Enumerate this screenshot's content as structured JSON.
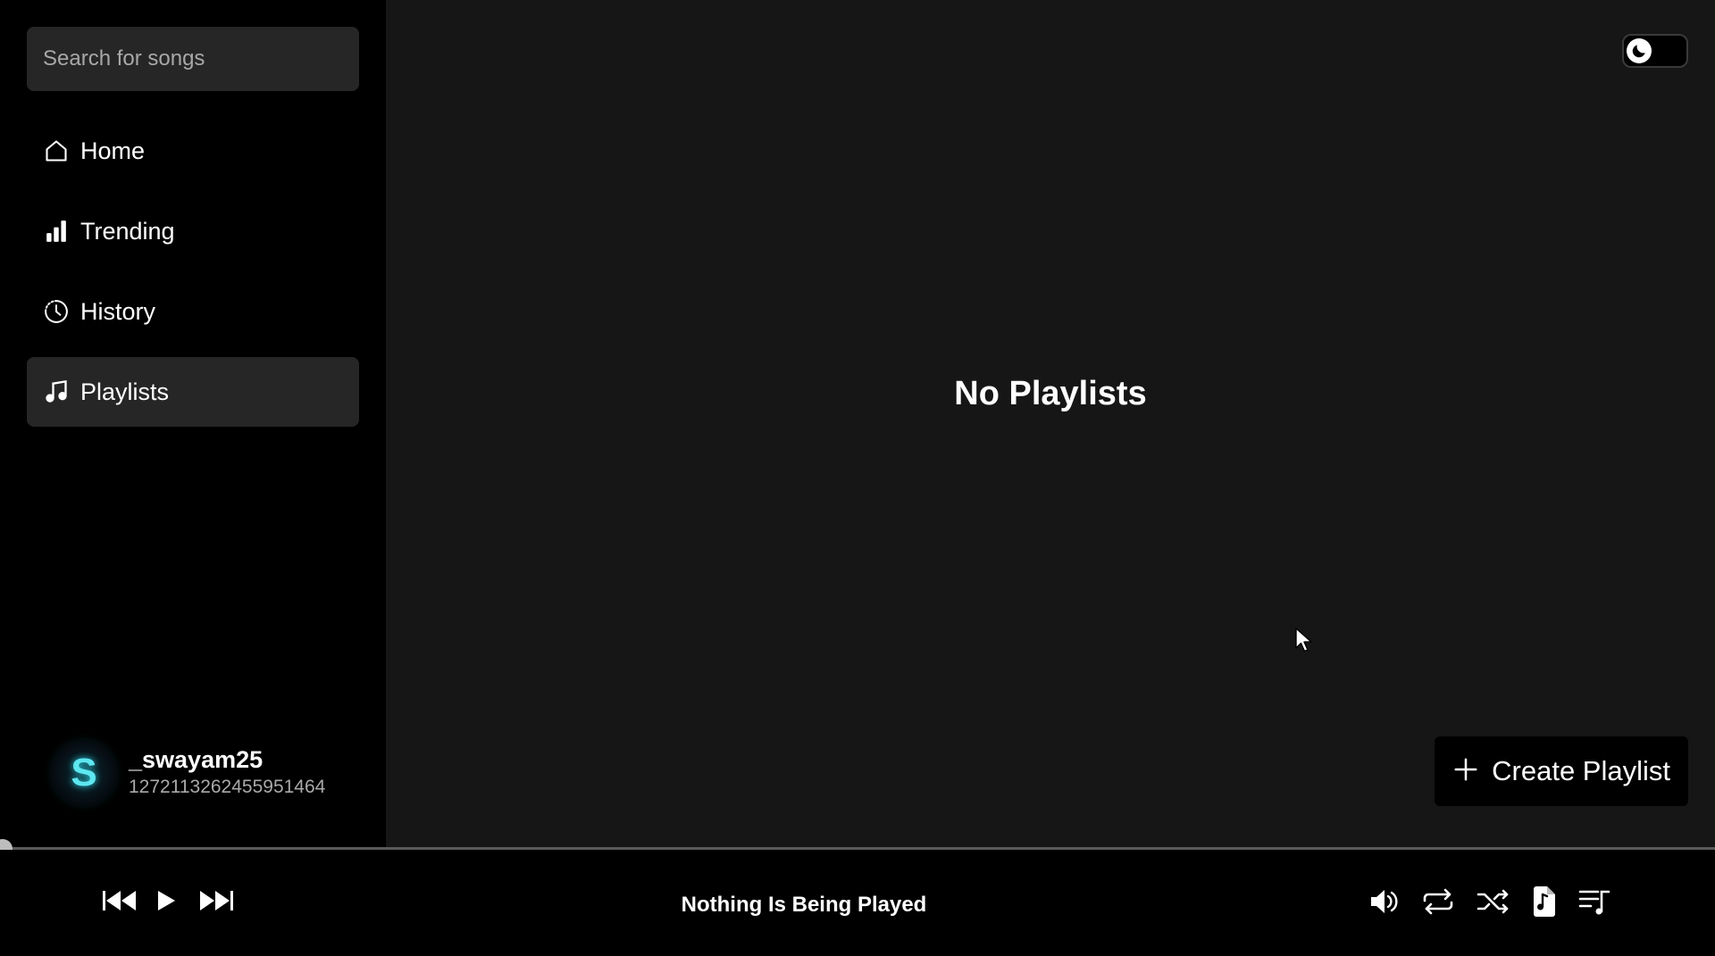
{
  "sidebar": {
    "search_placeholder": "Search for songs",
    "items": [
      {
        "label": "Home",
        "icon": "home-icon"
      },
      {
        "label": "Trending",
        "icon": "bar-chart-icon"
      },
      {
        "label": "History",
        "icon": "clock-icon"
      },
      {
        "label": "Playlists",
        "icon": "music-note-icon",
        "active": true
      }
    ],
    "user": {
      "avatar_letter": "S",
      "username": "_swayam25",
      "id": "1272113262455951464"
    }
  },
  "main": {
    "empty_title": "No Playlists",
    "create_label": "Create Playlist"
  },
  "player": {
    "now_playing": "Nothing Is Being Played"
  },
  "colors": {
    "sidebar_bg": "#000000",
    "main_bg": "#161616",
    "active_item_bg": "#262626",
    "avatar_accent": "#5ee7f0"
  }
}
